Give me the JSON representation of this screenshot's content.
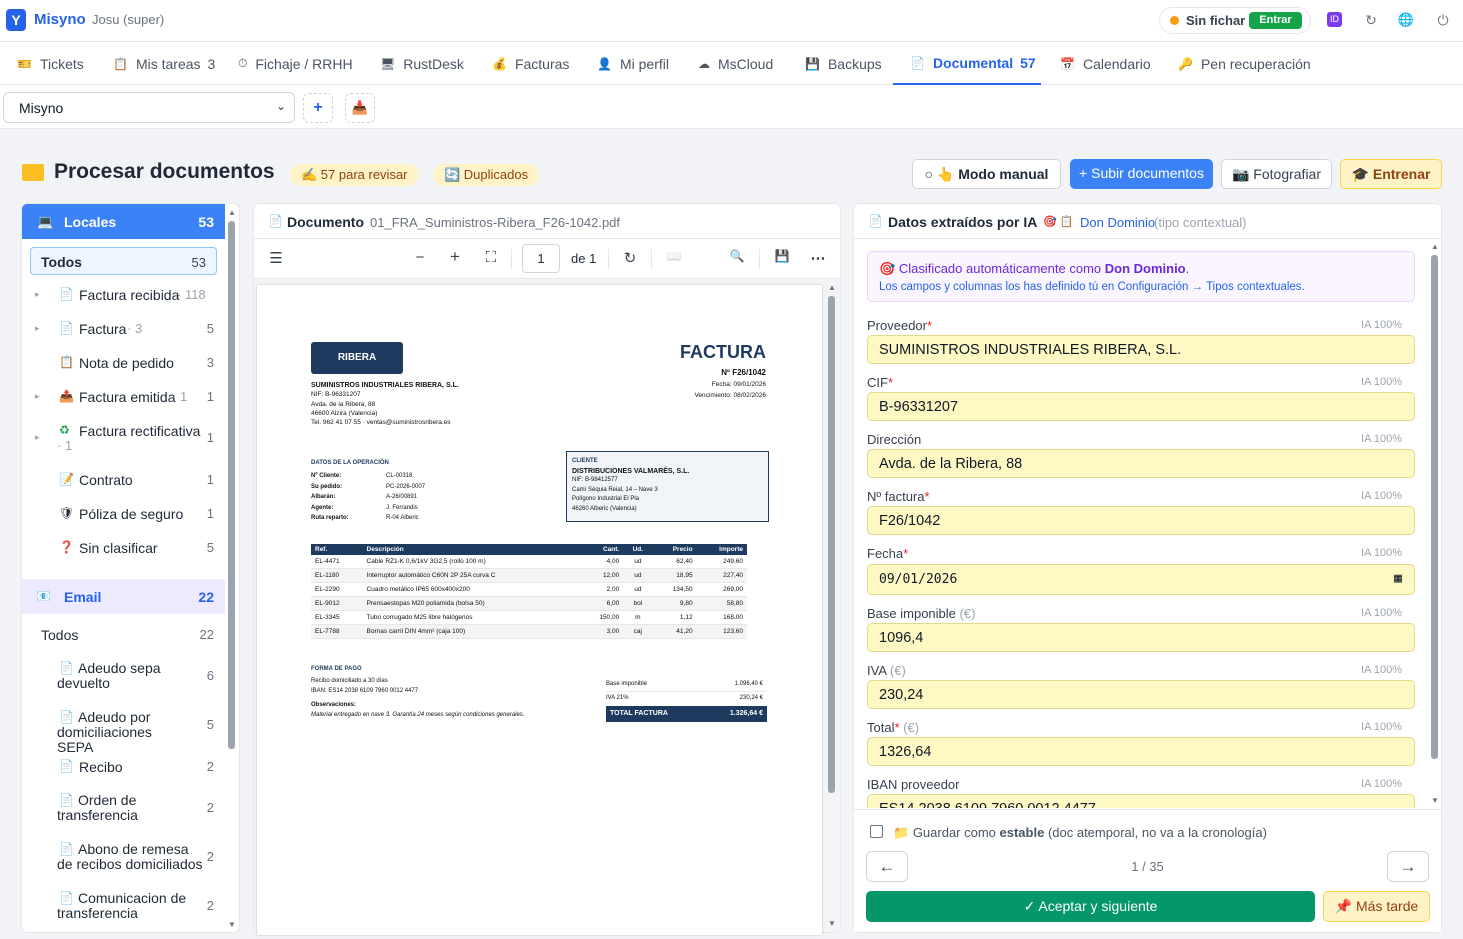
{
  "app": {
    "logo": "Y",
    "name": "Misyno",
    "user": "Josu (super)"
  },
  "fichar": {
    "label": "Sin fichar",
    "button": "Entrar"
  },
  "top_icons": [
    "id-icon",
    "refresh-icon",
    "globe-icon",
    "power-icon"
  ],
  "top_icons_text": {
    "id": "ID",
    "refresh": "↻",
    "globe": "🌐",
    "power": "⏻"
  },
  "tabs": [
    {
      "icon": "🎫",
      "label": "Tickets",
      "count": ""
    },
    {
      "icon": "📋",
      "label": "Mis tareas",
      "count": "3"
    },
    {
      "icon": "⏱",
      "label": "Fichaje / RRHH",
      "count": ""
    },
    {
      "icon": "🖥",
      "label": "RustDesk",
      "count": ""
    },
    {
      "icon": "💰",
      "label": "Facturas",
      "count": ""
    },
    {
      "icon": "👤",
      "label": "Mi perfil",
      "count": ""
    },
    {
      "icon": "☁",
      "label": "MsCloud",
      "count": ""
    },
    {
      "icon": "💾",
      "label": "Backups",
      "count": ""
    },
    {
      "icon": "📄",
      "label": "Documental",
      "count": "57"
    },
    {
      "icon": "📅",
      "label": "Calendario",
      "count": ""
    },
    {
      "icon": "🔑",
      "label": "Pen recuperación",
      "count": ""
    }
  ],
  "company_select": {
    "value": "Misyno"
  },
  "toolbar_buttons": {
    "add": "+",
    "inbox": "📥"
  },
  "page": {
    "title": "Procesar documentos",
    "review_pill": "✍ 57 para revisar",
    "dup_pill": "🔄 Duplicados"
  },
  "header_buttons": {
    "manual": "○ 👆 Modo manual",
    "upload": "+ Subir documentos",
    "photo": "📷 Fotografiar",
    "train": "🎓 Entrenar"
  },
  "sidebar": {
    "locales": {
      "label": "Locales",
      "count": "53",
      "todos": "Todos",
      "todos_count": "53"
    },
    "local_items": [
      {
        "arrow": "▸",
        "icon": "📄",
        "label": "Factura recibida",
        "sub": "· 118",
        "count": ""
      },
      {
        "arrow": "▸",
        "icon": "📄",
        "label": "Factura",
        "sub": "· 3",
        "count": "5"
      },
      {
        "arrow": "",
        "icon": "📋",
        "label": "Nota de pedido",
        "sub": "",
        "count": "3"
      },
      {
        "arrow": "▸",
        "icon": "📤",
        "label": "Factura emitida",
        "sub": "· 1",
        "count": "1"
      },
      {
        "arrow": "▸",
        "icon": "♻",
        "label": "Factura rectificativa",
        "sub": "· 1",
        "count": "1"
      },
      {
        "arrow": "",
        "icon": "📝",
        "label": "Contrato",
        "sub": "",
        "count": "1"
      },
      {
        "arrow": "",
        "icon": "🛡",
        "label": "Póliza de seguro",
        "sub": "",
        "count": "1"
      },
      {
        "arrow": "",
        "icon": "❓",
        "label": "Sin clasificar",
        "sub": "",
        "count": "5"
      }
    ],
    "email": {
      "label": "Email",
      "count": "22",
      "todos": "Todos",
      "todos_count": "22"
    },
    "email_items": [
      {
        "icon": "📄",
        "label": "Adeudo sepa devuelto",
        "count": "6"
      },
      {
        "icon": "📄",
        "label": "Adeudo por domiciliaciones SEPA",
        "count": "5"
      },
      {
        "icon": "📄",
        "label": "Recibo",
        "count": "2"
      },
      {
        "icon": "📄",
        "label": "Orden de transferencia",
        "count": "2"
      },
      {
        "icon": "📄",
        "label": "Abono de remesa de recibos domiciliados",
        "count": "2"
      },
      {
        "icon": "📄",
        "label": "Comunicacion de transferencia",
        "count": "2"
      }
    ]
  },
  "document": {
    "heading": "Documento",
    "filename": "01_FRA_Suministros-Ribera_F26-1042.pdf",
    "page": "1",
    "of": "de 1"
  },
  "pdf_toolbar_icons": {
    "outline": "☰",
    "zoom_out": "−",
    "zoom_in": "+",
    "fit": "⛶",
    "rotate": "↻",
    "spread": "📖",
    "search": "🔍",
    "save": "💾",
    "more": "⋯"
  },
  "invoice": {
    "logo": "RIBERA",
    "title": "FACTURA",
    "number": "Nº F26/1042",
    "date": "Fecha: 09/01/2026",
    "due": "Vencimiento: 08/02/2026",
    "issuer": [
      "SUMINISTROS INDUSTRIALES RIBERA, S.L.",
      "NIF: B-96331207",
      "Avda. de la Ribera, 88",
      "46600 Alzira (Valencia)",
      "Tel. 962 41 07 55 · ventas@suministrosribera.es"
    ],
    "op_title": "DATOS DE LA OPERACIÓN",
    "op": [
      [
        "Nº Cliente:",
        "CL-00318"
      ],
      [
        "Su pedido:",
        "PC-2026-0007"
      ],
      [
        "Albarán:",
        "A-26/00891"
      ],
      [
        "Agente:",
        "J. Ferrandis"
      ],
      [
        "Ruta reparto:",
        "R-04 Alberic"
      ]
    ],
    "client_title": "CLIENTE",
    "client": [
      "DISTRIBUCIONES VALMARÉS, S.L.",
      "NIF: B-98412577",
      "Camí Sèquia Reial, 14 – Nave 3",
      "Polígono Industrial El Pla",
      "46260 Alberic (Valencia)"
    ],
    "table_headers": [
      "Ref.",
      "Descripción",
      "Cant.",
      "Ud.",
      "Precio",
      "Importe"
    ],
    "rows": [
      [
        "EL-4471",
        "Cable RZ1-K 0,6/1kV 3G2,5 (rollo 100 m)",
        "4,00",
        "ud",
        "62,40",
        "249,60"
      ],
      [
        "EL-1180",
        "Interruptor automático C60N 2P 25A curva C",
        "12,00",
        "ud",
        "18,95",
        "227,40"
      ],
      [
        "EL-2290",
        "Cuadro metálico IP65 600x400x200",
        "2,00",
        "ud",
        "134,50",
        "269,00"
      ],
      [
        "EL-9012",
        "Prensaestopas M20 poliamida (bolsa 50)",
        "6,00",
        "bol",
        "9,80",
        "58,80"
      ],
      [
        "EL-3345",
        "Tubo corrugado M25 libre halógenos",
        "150,00",
        "m",
        "1,12",
        "168,00"
      ],
      [
        "EL-7788",
        "Bornas carril DIN 4mm² (caja 100)",
        "3,00",
        "caj",
        "41,20",
        "123,60"
      ]
    ],
    "pay_title": "FORMA DE PAGO",
    "pay": [
      "Recibo domiciliado a 30 días",
      "IBAN: ES14 2038 6109 7960 0012 4477"
    ],
    "obs_title": "Observaciones:",
    "obs": "Material entregado en nave 3. Garantía 24 meses según condiciones generales.",
    "base_label": "Base imponible",
    "base": "1.096,40 €",
    "iva_label": "IVA 21%",
    "iva": "230,24 €",
    "total_label": "TOTAL FACTURA",
    "total": "1.326,64 €"
  },
  "extracted": {
    "heading": "Datos extraídos por IA",
    "type_icon": "🎯 📋",
    "type": "Don Dominio",
    "type_note": "(tipo contextual)",
    "info_line1_pre": "Clasificado automáticamente como ",
    "info_line1_type": "Don Dominio",
    "info_line1_post": ".",
    "info_line2": "Los campos y columnas los has definido tú en Configuración → Tipos contextuales.",
    "fields": [
      {
        "label": "Proveedor",
        "req": "*",
        "unit": "",
        "ia": "IA 100%",
        "value": "SUMINISTROS INDUSTRIALES RIBERA, S.L."
      },
      {
        "label": "CIF",
        "req": "*",
        "unit": "",
        "ia": "IA 100%",
        "value": "B-96331207"
      },
      {
        "label": "Dirección",
        "req": "",
        "unit": "",
        "ia": "IA 100%",
        "value": "Avda. de la Ribera, 88"
      },
      {
        "label": "Nº factura",
        "req": "*",
        "unit": "",
        "ia": "IA 100%",
        "value": "F26/1042"
      },
      {
        "label": "Fecha",
        "req": "*",
        "unit": "",
        "ia": "IA 100%",
        "value": "09/01/2026"
      },
      {
        "label": "Base imponible",
        "req": "",
        "unit": "(€)",
        "ia": "IA 100%",
        "value": "1096,4"
      },
      {
        "label": "IVA",
        "req": "",
        "unit": "(€)",
        "ia": "IA 100%",
        "value": "230,24"
      },
      {
        "label": "Total",
        "req": "*",
        "unit": "(€)",
        "ia": "IA 100%",
        "value": "1326,64"
      },
      {
        "label": "IBAN proveedor",
        "req": "",
        "unit": "",
        "ia": "IA 100%",
        "value": "ES14 2038 6109 7960 0012 4477"
      }
    ],
    "stable_pre": "Guardar como ",
    "stable_bold": "estable",
    "stable_post": " (doc atemporal, no va a la cronología)",
    "prev": "←",
    "next": "→",
    "pager": "1 / 35",
    "accept": "✓ Aceptar y siguiente",
    "later": "📌 Más tarde"
  }
}
